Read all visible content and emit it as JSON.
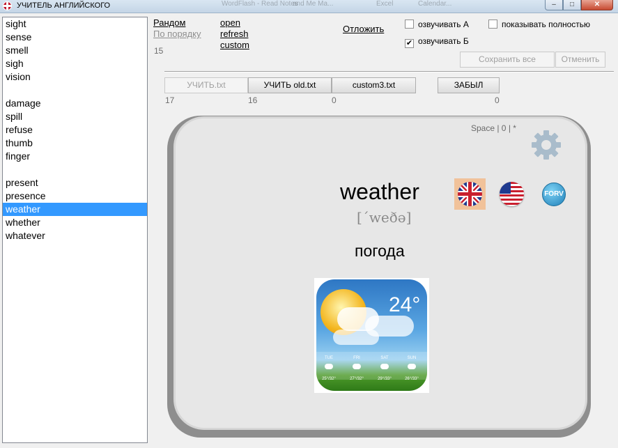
{
  "window": {
    "title": "УЧИТЕЛЬ АНГЛИЙСКОГО",
    "behind_titles": [
      "WordFlash - Read Notes",
      "and Me Ma...",
      "Excel",
      "Calendar..."
    ],
    "controls": {
      "minimize": "–",
      "maximize": "□",
      "close": "✕"
    }
  },
  "word_list": {
    "items": [
      "sight",
      "sense",
      "smell",
      "sigh",
      "vision",
      "",
      "damage",
      "spill",
      "refuse",
      "thumb",
      "finger",
      "",
      "present",
      "presence",
      "weather",
      "whether",
      "whatever"
    ],
    "selected_index": 14
  },
  "links": {
    "random": "Рандом",
    "in_order": "По порядку",
    "open": "open",
    "refresh": "refresh",
    "custom": "custom",
    "postpone": "Отложить"
  },
  "count_label": "15",
  "checkboxes": {
    "voice_a": {
      "label": "озвучивать А",
      "checked": false
    },
    "voice_b": {
      "label": "озвучивать Б",
      "checked": true
    },
    "show_full": {
      "label": "показывать полностью",
      "checked": false
    }
  },
  "buttons": {
    "save_all": "Сохранить все",
    "cancel": "Отменить",
    "learn_txt": "УЧИТЬ.txt",
    "learn_old": "УЧИТЬ old.txt",
    "custom3": "custom3.txt",
    "forgot": "ЗАБЫЛ"
  },
  "counts": {
    "learn_txt": "17",
    "learn_old": "16",
    "custom3": "0",
    "forgot": "0"
  },
  "card": {
    "space_info": "Space | 0 | *",
    "word": "weather",
    "transcription": "[ˊweðə]",
    "translation": "погода",
    "settings_icon": "gear-icon",
    "pronunciation_sources": [
      "uk-flag-icon",
      "us-flag-icon",
      "forvo-icon"
    ],
    "forvo_label": "FORV"
  },
  "weather_image": {
    "temperature": "24°",
    "days": [
      "TUE",
      "FRI",
      "SAT",
      "SUN"
    ],
    "temps": [
      "25°/32°",
      "27°/32°",
      "29°/33°",
      "26°/33°"
    ]
  },
  "colors": {
    "selection": "#3399ff",
    "card": "#e7e7e7",
    "card_shadow": "#8e8e8e",
    "uk_frame": "#f1c29a"
  }
}
